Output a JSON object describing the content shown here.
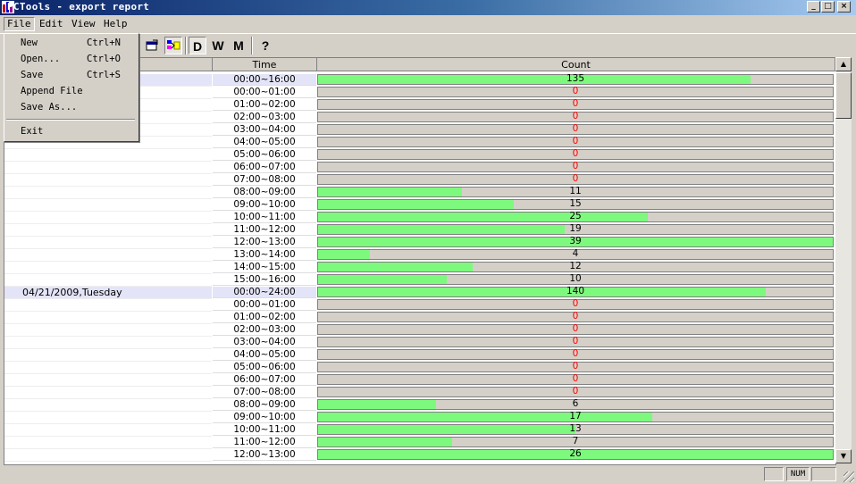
{
  "window": {
    "title": "PCTools - export report"
  },
  "menubar": {
    "file": "File",
    "edit": "Edit",
    "view": "View",
    "help": "Help"
  },
  "file_menu": {
    "items": [
      {
        "label": "New",
        "shortcut": "Ctrl+N"
      },
      {
        "label": "Open...",
        "shortcut": "Ctrl+O"
      },
      {
        "label": "Save",
        "shortcut": "Ctrl+S"
      },
      {
        "label": "Append File",
        "shortcut": ""
      },
      {
        "label": "Save As...",
        "shortcut": ""
      }
    ],
    "exit": "Exit"
  },
  "toolbar": {
    "day": "D",
    "week": "W",
    "month": "M",
    "help": "?"
  },
  "table": {
    "headers": {
      "time": "Time",
      "count": "Count"
    },
    "max_count": 39,
    "rows": [
      {
        "date": "",
        "time": "00:00~16:00",
        "count": "135",
        "fill": 0.84,
        "highlight": true
      },
      {
        "date": "",
        "time": "00:00~01:00",
        "count": "0",
        "fill": 0
      },
      {
        "date": "",
        "time": "01:00~02:00",
        "count": "0",
        "fill": 0
      },
      {
        "date": "",
        "time": "02:00~03:00",
        "count": "0",
        "fill": 0
      },
      {
        "date": "",
        "time": "03:00~04:00",
        "count": "0",
        "fill": 0
      },
      {
        "date": "",
        "time": "04:00~05:00",
        "count": "0",
        "fill": 0
      },
      {
        "date": "",
        "time": "05:00~06:00",
        "count": "0",
        "fill": 0
      },
      {
        "date": "",
        "time": "06:00~07:00",
        "count": "0",
        "fill": 0
      },
      {
        "date": "",
        "time": "07:00~08:00",
        "count": "0",
        "fill": 0
      },
      {
        "date": "",
        "time": "08:00~09:00",
        "count": "11",
        "fill": 0.28
      },
      {
        "date": "",
        "time": "09:00~10:00",
        "count": "15",
        "fill": 0.38
      },
      {
        "date": "",
        "time": "10:00~11:00",
        "count": "25",
        "fill": 0.64
      },
      {
        "date": "",
        "time": "11:00~12:00",
        "count": "19",
        "fill": 0.48
      },
      {
        "date": "",
        "time": "12:00~13:00",
        "count": "39",
        "fill": 1.0
      },
      {
        "date": "",
        "time": "13:00~14:00",
        "count": "4",
        "fill": 0.1
      },
      {
        "date": "",
        "time": "14:00~15:00",
        "count": "12",
        "fill": 0.3
      },
      {
        "date": "",
        "time": "15:00~16:00",
        "count": "10",
        "fill": 0.25
      },
      {
        "date": "04/21/2009,Tuesday",
        "time": "00:00~24:00",
        "count": "140",
        "fill": 0.87,
        "highlight": true
      },
      {
        "date": "",
        "time": "00:00~01:00",
        "count": "0",
        "fill": 0
      },
      {
        "date": "",
        "time": "01:00~02:00",
        "count": "0",
        "fill": 0
      },
      {
        "date": "",
        "time": "02:00~03:00",
        "count": "0",
        "fill": 0
      },
      {
        "date": "",
        "time": "03:00~04:00",
        "count": "0",
        "fill": 0
      },
      {
        "date": "",
        "time": "04:00~05:00",
        "count": "0",
        "fill": 0
      },
      {
        "date": "",
        "time": "05:00~06:00",
        "count": "0",
        "fill": 0
      },
      {
        "date": "",
        "time": "06:00~07:00",
        "count": "0",
        "fill": 0
      },
      {
        "date": "",
        "time": "07:00~08:00",
        "count": "0",
        "fill": 0
      },
      {
        "date": "",
        "time": "08:00~09:00",
        "count": "6",
        "fill": 0.23
      },
      {
        "date": "",
        "time": "09:00~10:00",
        "count": "17",
        "fill": 0.65
      },
      {
        "date": "",
        "time": "10:00~11:00",
        "count": "13",
        "fill": 0.5
      },
      {
        "date": "",
        "time": "11:00~12:00",
        "count": "7",
        "fill": 0.26
      },
      {
        "date": "",
        "time": "12:00~13:00",
        "count": "26",
        "fill": 1.0
      }
    ]
  },
  "statusbar": {
    "num": "NUM"
  },
  "colors": {
    "bar": "#7dfa7d",
    "zero": "#ff0000",
    "highlight_row": "#e4e4f8"
  }
}
